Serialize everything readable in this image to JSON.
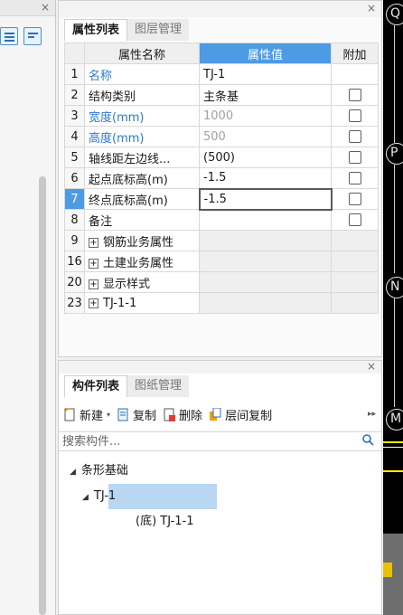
{
  "property_panel": {
    "tabs": [
      "属性列表",
      "图层管理"
    ],
    "headers": {
      "name": "属性名称",
      "value": "属性值",
      "extra": "附加"
    },
    "rows": [
      {
        "num": "1",
        "name": "名称",
        "value": "TJ-1"
      },
      {
        "num": "2",
        "name": "结构类别",
        "value": "主条基"
      },
      {
        "num": "3",
        "name": "宽度(mm)",
        "value": "1000"
      },
      {
        "num": "4",
        "name": "高度(mm)",
        "value": "500"
      },
      {
        "num": "5",
        "name": "轴线距左边线...",
        "value": "(500)"
      },
      {
        "num": "6",
        "name": "起点底标高(m)",
        "value": "-1.5"
      },
      {
        "num": "7",
        "name": "终点底标高(m)",
        "value": "-1.5"
      },
      {
        "num": "8",
        "name": "备注",
        "value": ""
      },
      {
        "num": "9",
        "name": "钢筋业务属性",
        "value": ""
      },
      {
        "num": "16",
        "name": "土建业务属性",
        "value": ""
      },
      {
        "num": "20",
        "name": "显示样式",
        "value": ""
      },
      {
        "num": "23",
        "name": "TJ-1-1",
        "value": ""
      }
    ]
  },
  "component_panel": {
    "tabs": [
      "构件列表",
      "图纸管理"
    ],
    "toolbar": {
      "new": "新建",
      "copy": "复制",
      "delete": "删除",
      "floor_copy": "层间复制"
    },
    "search_placeholder": "搜索构件...",
    "tree": {
      "root": "条形基础",
      "child": "TJ-1",
      "grandchild": "(底) TJ-1-1"
    }
  },
  "canvas": {
    "axes": [
      "Q",
      "P",
      "N",
      "M"
    ]
  },
  "colors": {
    "accent": "#4d9be4",
    "selection": "#b9d6f3",
    "link_text": "#2a7ad3"
  }
}
